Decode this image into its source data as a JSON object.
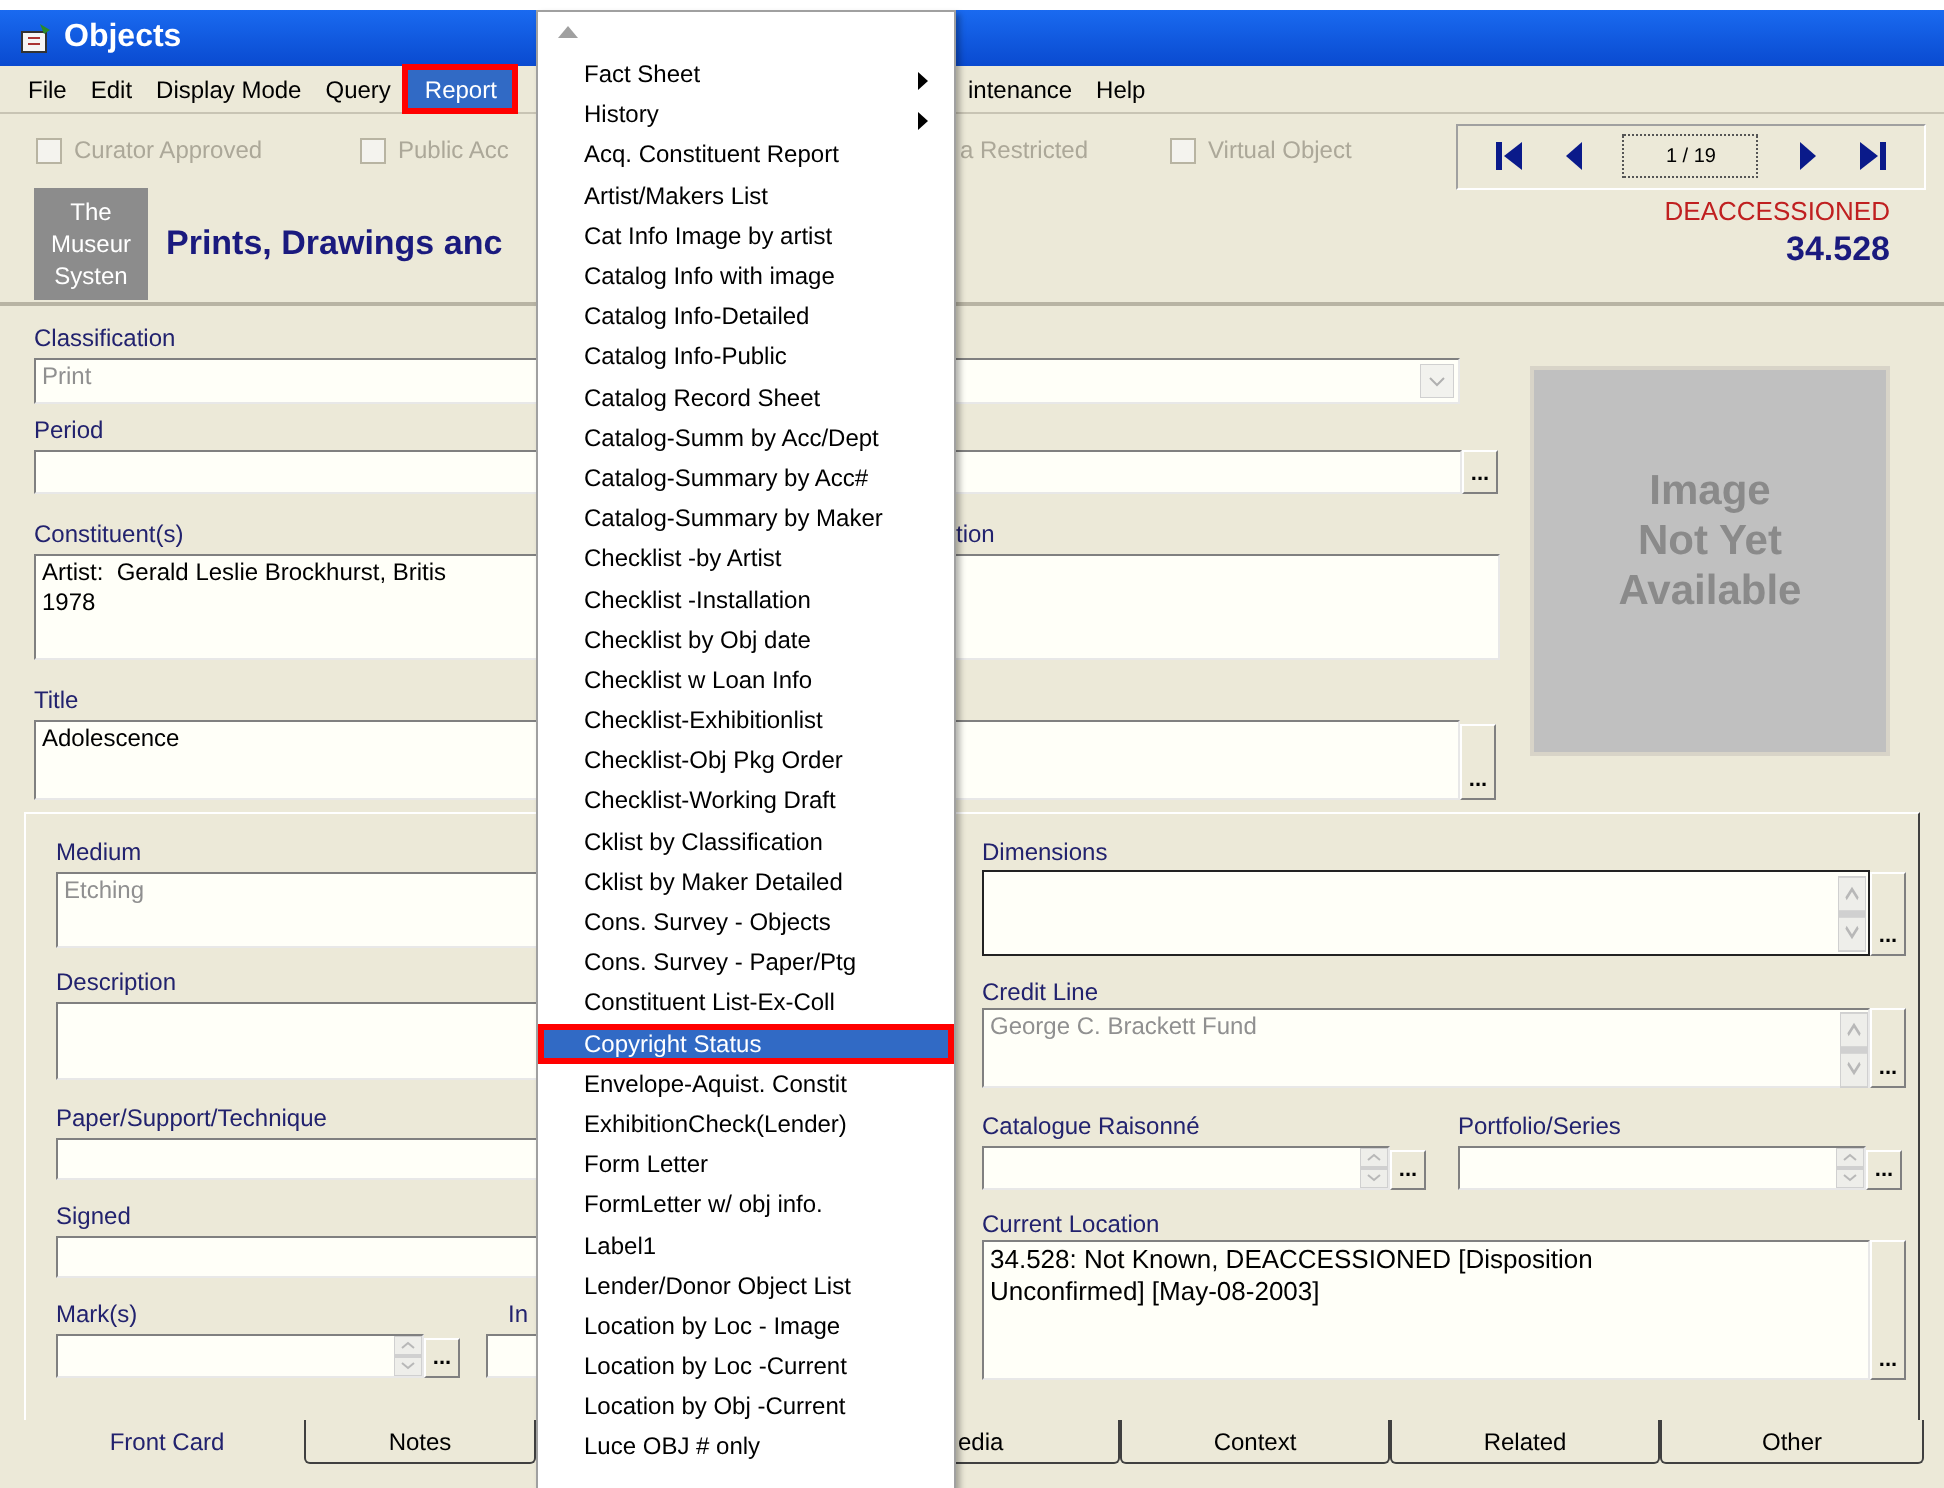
{
  "window": {
    "title": "Objects"
  },
  "menu_bar": [
    {
      "label": "File",
      "selected": false,
      "annotated": false
    },
    {
      "label": "Edit",
      "selected": false,
      "annotated": false
    },
    {
      "label": "Display Mode",
      "selected": false,
      "annotated": false
    },
    {
      "label": "Query",
      "selected": false,
      "annotated": false
    },
    {
      "label": "Report",
      "selected": true,
      "annotated": true
    },
    {
      "label": "intenance",
      "selected": false,
      "annotated": false
    },
    {
      "label": "Help",
      "selected": false,
      "annotated": false
    }
  ],
  "flags": [
    {
      "label": "Curator Approved",
      "checked": false
    },
    {
      "label": "Public Acc",
      "checked": false
    },
    {
      "label": "a Restricted"
    },
    {
      "label": "Virtual Object",
      "checked": false
    }
  ],
  "record_nav": {
    "position": "1 / 19"
  },
  "header": {
    "logo": [
      "The",
      "Museur",
      "Systen"
    ],
    "title": "Prints, Drawings anc",
    "status": "DEACCESSIONED",
    "number": "34.528"
  },
  "image_placeholder": "Image Not Yet Available",
  "classification": {
    "label": "Classification",
    "value": "Print",
    "disabled": true
  },
  "period": {
    "label": "Period",
    "browse_button": "..."
  },
  "constituents": {
    "label": "Constituent(s)",
    "value": "Artist:  Gerald Leslie Brockhurst, Britis\n1978",
    "disabled": false
  },
  "right_label": "tion",
  "title": {
    "label": "Title",
    "value": "Adolescence",
    "disabled": false,
    "browse_button": "..."
  },
  "medium": {
    "label": "Medium",
    "value": "Etching",
    "disabled": true
  },
  "description": {
    "label": "Description"
  },
  "paper": {
    "label": "Paper/Support/Technique"
  },
  "signed": {
    "label": "Signed"
  },
  "marks": {
    "label": "Mark(s)",
    "browse_button": "..."
  },
  "marks_right_label": "In",
  "dimensions": {
    "label": "Dimensions",
    "browse_button": "..."
  },
  "credit_line": {
    "label": "Credit Line",
    "value": "George C. Brackett Fund",
    "disabled": true,
    "browse_button": "..."
  },
  "catalogue_raisonne": {
    "label": "Catalogue Raisonné",
    "browse_button": "..."
  },
  "portfolio_series": {
    "label": "Portfolio/Series",
    "browse_button": "..."
  },
  "current_location": {
    "label": "Current Location",
    "value": "34.528: Not Known, DEACCESSIONED [Disposition\nUnconfirmed] [May-08-2003]",
    "disabled": false,
    "browse_button": "..."
  },
  "tabs": [
    {
      "label": "Front Card",
      "selected": true
    },
    {
      "label": "Notes",
      "selected": false
    },
    {
      "label": "edia",
      "selected": false
    },
    {
      "label": "Context",
      "selected": false
    },
    {
      "label": "Related",
      "selected": false
    },
    {
      "label": "Other",
      "selected": false
    }
  ],
  "report_menu": {
    "items": [
      {
        "label": "Fact Sheet",
        "kind": "submenu",
        "selected": false,
        "annotated": false
      },
      {
        "label": "History",
        "kind": "submenu",
        "selected": false,
        "annotated": false
      },
      {
        "label": "Acq. Constituent Report",
        "kind": "item",
        "selected": false,
        "annotated": false
      },
      {
        "label": "Artist/Makers List",
        "kind": "item",
        "selected": false,
        "annotated": false
      },
      {
        "label": "Cat Info Image by artist",
        "kind": "item",
        "selected": false,
        "annotated": false
      },
      {
        "label": "Catalog Info with image",
        "kind": "item",
        "selected": false,
        "annotated": false
      },
      {
        "label": "Catalog Info-Detailed",
        "kind": "item",
        "selected": false,
        "annotated": false
      },
      {
        "label": "Catalog Info-Public",
        "kind": "item",
        "selected": false,
        "annotated": false
      },
      {
        "label": "Catalog Record Sheet",
        "kind": "item",
        "selected": false,
        "annotated": false
      },
      {
        "label": "Catalog-Summ by Acc/Dept",
        "kind": "item",
        "selected": false,
        "annotated": false
      },
      {
        "label": "Catalog-Summary by Acc#",
        "kind": "item",
        "selected": false,
        "annotated": false
      },
      {
        "label": "Catalog-Summary by Maker",
        "kind": "item",
        "selected": false,
        "annotated": false
      },
      {
        "label": "Checklist -by Artist",
        "kind": "item",
        "selected": false,
        "annotated": false
      },
      {
        "label": "Checklist -Installation",
        "kind": "item",
        "selected": false,
        "annotated": false
      },
      {
        "label": "Checklist by Obj date",
        "kind": "item",
        "selected": false,
        "annotated": false
      },
      {
        "label": "Checklist w Loan Info",
        "kind": "item",
        "selected": false,
        "annotated": false
      },
      {
        "label": "Checklist-Exhibitionlist",
        "kind": "item",
        "selected": false,
        "annotated": false
      },
      {
        "label": "Checklist-Obj Pkg Order",
        "kind": "item",
        "selected": false,
        "annotated": false
      },
      {
        "label": "Checklist-Working Draft",
        "kind": "item",
        "selected": false,
        "annotated": false
      },
      {
        "label": "Cklist by Classification",
        "kind": "item",
        "selected": false,
        "annotated": false
      },
      {
        "label": "Cklist by Maker Detailed",
        "kind": "item",
        "selected": false,
        "annotated": false
      },
      {
        "label": "Cons. Survey - Objects",
        "kind": "item",
        "selected": false,
        "annotated": false
      },
      {
        "label": "Cons. Survey - Paper/Ptg",
        "kind": "item",
        "selected": false,
        "annotated": false
      },
      {
        "label": "Constituent List-Ex-Coll",
        "kind": "item",
        "selected": false,
        "annotated": false
      },
      {
        "label": "Copyright Status",
        "kind": "item",
        "selected": true,
        "annotated": true
      },
      {
        "label": "Envelope-Aquist. Constit",
        "kind": "item",
        "selected": false,
        "annotated": false
      },
      {
        "label": "ExhibitionCheck(Lender)",
        "kind": "item",
        "selected": false,
        "annotated": false
      },
      {
        "label": "Form Letter",
        "kind": "item",
        "selected": false,
        "annotated": false
      },
      {
        "label": "FormLetter w/ obj info.",
        "kind": "item",
        "selected": false,
        "annotated": false
      },
      {
        "label": "Label1",
        "kind": "item",
        "selected": false,
        "annotated": false
      },
      {
        "label": "Lender/Donor Object List",
        "kind": "item",
        "selected": false,
        "annotated": false
      },
      {
        "label": "Location by Loc - Image",
        "kind": "item",
        "selected": false,
        "annotated": false
      },
      {
        "label": "Location by Loc -Current",
        "kind": "item",
        "selected": false,
        "annotated": false
      },
      {
        "label": "Location by Obj -Current",
        "kind": "item",
        "selected": false,
        "annotated": false
      },
      {
        "label": "Luce OBJ # only",
        "kind": "item",
        "selected": false,
        "annotated": false
      }
    ]
  }
}
